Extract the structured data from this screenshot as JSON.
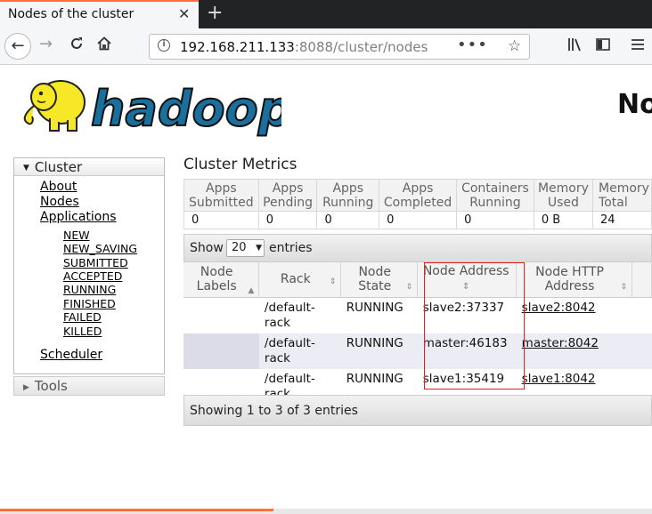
{
  "browser": {
    "tab_title": "Nodes of the cluster",
    "tab_close": "✕",
    "new_tab": "+",
    "url_host": "192.168.211.133",
    "url_rest": ":8088/cluster/nodes",
    "url_dots": "•••",
    "icons": [
      "back-arrow-icon",
      "forward-arrow-icon",
      "reload-icon",
      "home-icon",
      "info-icon",
      "bookmark-star-icon",
      "library-icon",
      "sidebar-icon",
      "hamburger-menu-icon"
    ]
  },
  "logo": {
    "text": "hadoop"
  },
  "page": {
    "heading": "Nodes of the cluster"
  },
  "sidebar": {
    "cluster_label": "Cluster",
    "links": {
      "about": "About",
      "nodes": "Nodes",
      "applications": "Applications",
      "scheduler": "Scheduler"
    },
    "app_states": [
      "NEW",
      "NEW_SAVING",
      "SUBMITTED",
      "ACCEPTED",
      "RUNNING",
      "FINISHED",
      "FAILED",
      "KILLED"
    ],
    "tools_label": "Tools"
  },
  "metrics": {
    "title": "Cluster Metrics",
    "headers": [
      [
        "Apps",
        "Submitted"
      ],
      [
        "Apps",
        "Pending"
      ],
      [
        "Apps",
        "Running"
      ],
      [
        "Apps",
        "Completed"
      ],
      [
        "Containers",
        "Running"
      ],
      [
        "Memory",
        "Used"
      ],
      [
        "Memory",
        "Total"
      ]
    ],
    "values": [
      "0",
      "0",
      "0",
      "0",
      "0",
      "0 B",
      "24"
    ]
  },
  "table": {
    "show_label": "Show",
    "page_size": "20",
    "entries_label": "entries",
    "headers": [
      [
        "Node",
        "Labels"
      ],
      [
        "Rack",
        ""
      ],
      [
        "Node",
        "State"
      ],
      [
        "Node Address",
        ""
      ],
      [
        "Node HTTP",
        "Address"
      ]
    ],
    "rows": [
      {
        "labels": "",
        "rack": [
          "/default-",
          "rack"
        ],
        "state": "RUNNING",
        "address": "slave2:37337",
        "http": "slave2:8042"
      },
      {
        "labels": "",
        "rack": [
          "/default-",
          "rack"
        ],
        "state": "RUNNING",
        "address": "master:46183",
        "http": "master:8042"
      },
      {
        "labels": "",
        "rack": [
          "/default-",
          "rack"
        ],
        "state": "RUNNING",
        "address": "slave1:35419",
        "http": "slave1:8042"
      }
    ],
    "info": "Showing 1 to 3 of 3 entries"
  }
}
